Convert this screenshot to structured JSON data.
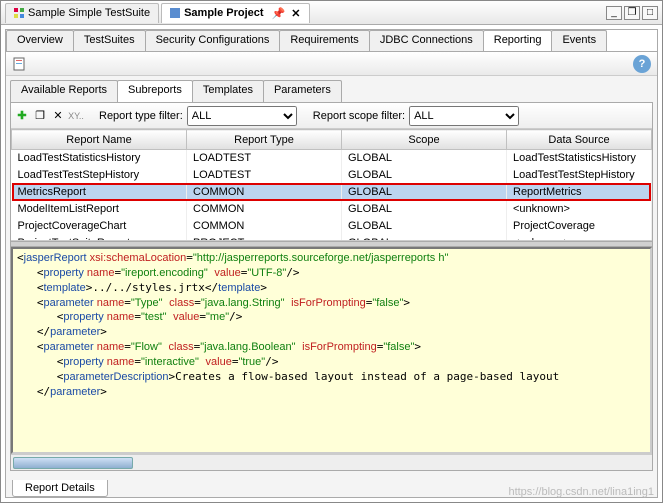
{
  "window": {
    "tabs": [
      {
        "label": "Sample Simple TestSuite",
        "active": false
      },
      {
        "label": "Sample Project",
        "active": true
      }
    ]
  },
  "sections": {
    "tabs": [
      "Overview",
      "TestSuites",
      "Security Configurations",
      "Requirements",
      "JDBC Connections",
      "Reporting",
      "Events"
    ],
    "active": "Reporting"
  },
  "report_tabs": {
    "tabs": [
      "Available Reports",
      "Subreports",
      "Templates",
      "Parameters"
    ],
    "active": "Subreports"
  },
  "filters": {
    "type_label": "Report type filter:",
    "type_value": "ALL",
    "scope_label": "Report scope filter:",
    "scope_value": "ALL",
    "xy_label": "XY.."
  },
  "table": {
    "headers": [
      "Report Name",
      "Report Type",
      "Scope",
      "Data Source"
    ],
    "rows": [
      {
        "name": "LoadTestStatisticsHistory",
        "type": "LOADTEST",
        "scope": "GLOBAL",
        "ds": "LoadTestStatisticsHistory"
      },
      {
        "name": "LoadTestTestStepHistory",
        "type": "LOADTEST",
        "scope": "GLOBAL",
        "ds": "LoadTestTestStepHistory"
      },
      {
        "name": "MetricsReport",
        "type": "COMMON",
        "scope": "GLOBAL",
        "ds": "ReportMetrics",
        "hl": true
      },
      {
        "name": "ModelItemListReport",
        "type": "COMMON",
        "scope": "GLOBAL",
        "ds": "<unknown>"
      },
      {
        "name": "ProjectCoverageChart",
        "type": "COMMON",
        "scope": "GLOBAL",
        "ds": "ProjectCoverage"
      },
      {
        "name": "ProjectTestSuiteReport",
        "type": "PROJECT",
        "scope": "GLOBAL",
        "ds": "<unknown>"
      }
    ]
  },
  "xml": {
    "root_open_prefix": "jasperReport ",
    "schemaLoc_attr": "xsi:schemaLocation",
    "schemaLoc_val": "http://jasperreports.sourceforge.net/jasperreports h",
    "prop1_name": "ireport.encoding",
    "prop1_val": "UTF-8",
    "template_path": "../../styles.jrtx",
    "param1_name": "Type",
    "param1_class": "java.lang.String",
    "param1_prompt": "false",
    "param1_inner_name": "test",
    "param1_inner_val": "me",
    "param2_name": "Flow",
    "param2_class": "java.lang.Boolean",
    "param2_prompt": "false",
    "param2_inner_name": "interactive",
    "param2_inner_val": "true",
    "param2_desc": "Creates a flow-based layout instead of a page-based layout"
  },
  "bottom_tab": "Report Details",
  "watermark": "https://blog.csdn.net/lina1ing1"
}
